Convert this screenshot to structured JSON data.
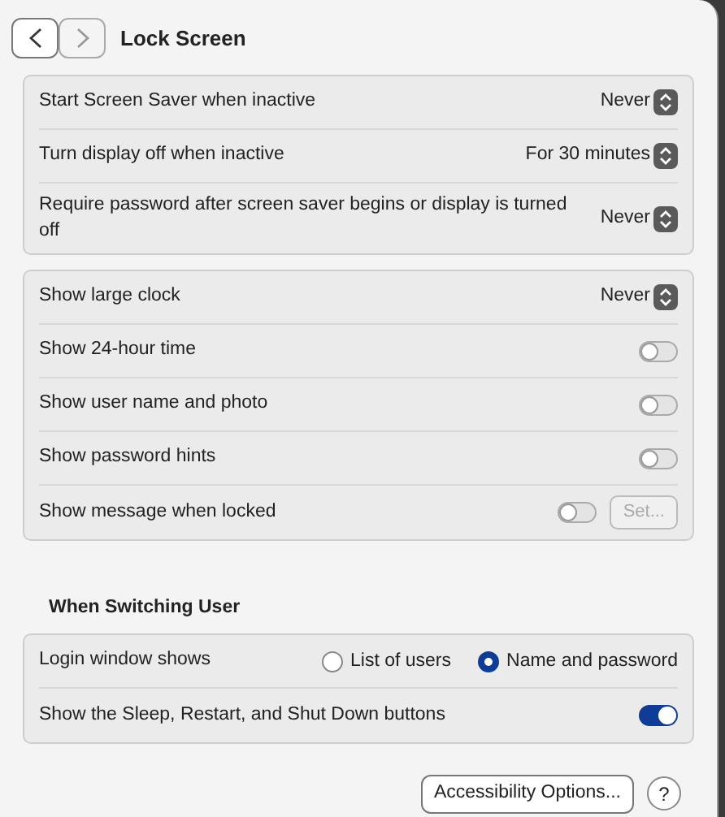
{
  "window": {
    "title": "Lock Screen"
  },
  "nav": {
    "back_disabled": false,
    "forward_disabled": true
  },
  "groups": [
    {
      "rows": [
        {
          "kind": "popup",
          "label": "Start Screen Saver when inactive",
          "value": "Never"
        },
        {
          "kind": "popup",
          "label": "Turn display off when inactive",
          "value": "For 30 minutes"
        },
        {
          "kind": "popup",
          "label": "Require password after screen saver begins or display is turned off",
          "value": "Never"
        }
      ]
    },
    {
      "rows": [
        {
          "kind": "popup",
          "label": "Show large clock",
          "value": "Never"
        },
        {
          "kind": "toggle",
          "label": "Show 24-hour time",
          "on": false
        },
        {
          "kind": "toggle",
          "label": "Show user name and photo",
          "on": false
        },
        {
          "kind": "toggle",
          "label": "Show password hints",
          "on": false
        },
        {
          "kind": "toggle",
          "label": "Show message when locked",
          "on": false,
          "button": {
            "label": "Set...",
            "disabled": true
          }
        }
      ]
    },
    {
      "heading": "When Switching User",
      "rows": [
        {
          "kind": "radio",
          "label": "Login window shows",
          "options": [
            {
              "label": "List of users",
              "selected": false
            },
            {
              "label": "Name and password",
              "selected": true
            }
          ]
        },
        {
          "kind": "toggle",
          "label": "Show the Sleep, Restart, and Shut Down buttons",
          "on": true
        }
      ]
    }
  ],
  "footer": {
    "button": "Accessibility Options...",
    "help": "?"
  }
}
